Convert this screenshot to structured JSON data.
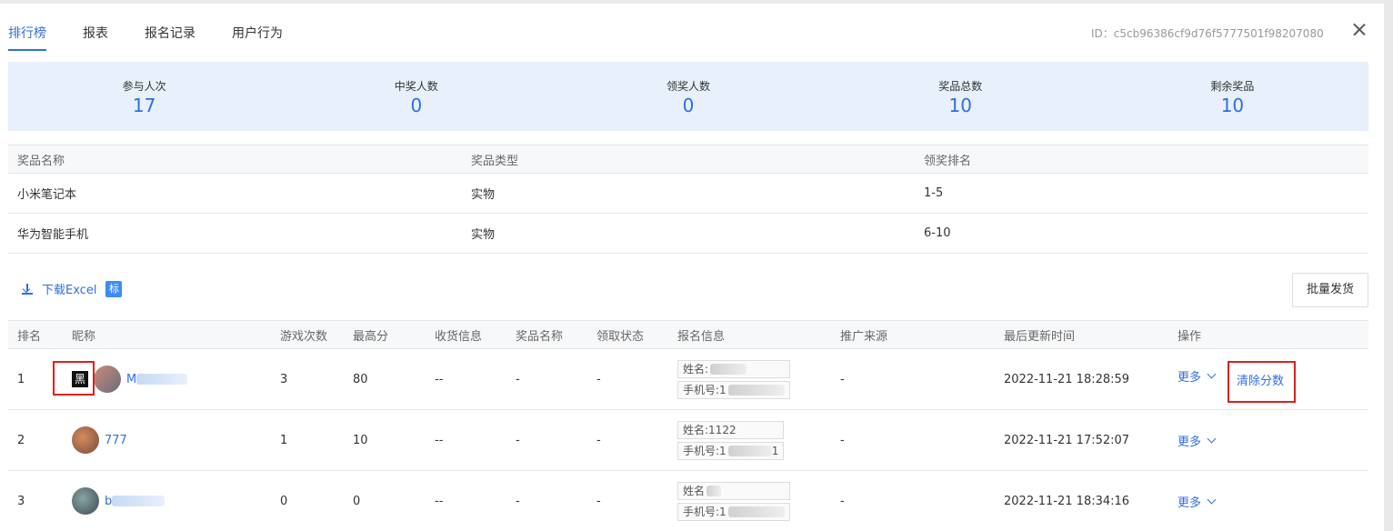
{
  "tabs": [
    {
      "label": "排行榜",
      "active": true
    },
    {
      "label": "报表"
    },
    {
      "label": "报名记录"
    },
    {
      "label": "用户行为"
    }
  ],
  "id_text": "ID：c5cb96386cf9d76f5777501f98207080",
  "stats": [
    {
      "label": "参与人次",
      "value": "17"
    },
    {
      "label": "中奖人数",
      "value": "0"
    },
    {
      "label": "领奖人数",
      "value": "0"
    },
    {
      "label": "奖品总数",
      "value": "10"
    },
    {
      "label": "剩余奖品",
      "value": "10"
    }
  ],
  "prize_table": {
    "headers": [
      "奖品名称",
      "奖品类型",
      "领奖排名"
    ],
    "rows": [
      [
        "小米笔记本",
        "实物",
        "1-5"
      ],
      [
        "华为智能手机",
        "实物",
        "6-10"
      ]
    ]
  },
  "toolbar": {
    "download_label": "下载Excel",
    "badge": "标",
    "batch_label": "批量发货"
  },
  "main_table": {
    "headers": [
      "排名",
      "昵称",
      "游戏次数",
      "最高分",
      "收货信息",
      "奖品名称",
      "领取状态",
      "报名信息",
      "推广来源",
      "最后更新时间",
      "操作"
    ],
    "rows": [
      {
        "rank": "1",
        "badge": "黑",
        "nick": "M",
        "plays": "3",
        "score": "80",
        "shipping": "--",
        "prize": "-",
        "status": "-",
        "name_line": "姓名:",
        "phone_line": "手机号:1",
        "source": "-",
        "updated": "2022-11-21 18:28:59",
        "more": "更多",
        "clear": "清除分数"
      },
      {
        "rank": "2",
        "nick": "777",
        "plays": "1",
        "score": "10",
        "shipping": "--",
        "prize": "-",
        "status": "-",
        "name_line": "姓名:1122",
        "phone_line": "手机号:1",
        "phone_tail": "1",
        "source": "-",
        "updated": "2022-11-21 17:52:07",
        "more": "更多"
      },
      {
        "rank": "3",
        "nick": "b",
        "plays": "0",
        "score": "0",
        "shipping": "--",
        "prize": "-",
        "status": "-",
        "name_line": "姓名",
        "phone_line": "手机号:1",
        "source": "-",
        "updated": "2022-11-21 18:34:16",
        "more": "更多"
      }
    ]
  },
  "colors": {
    "accent": "#2f6fe0",
    "stats_bg": "#e7f0fb",
    "highlight": "#e02020"
  }
}
